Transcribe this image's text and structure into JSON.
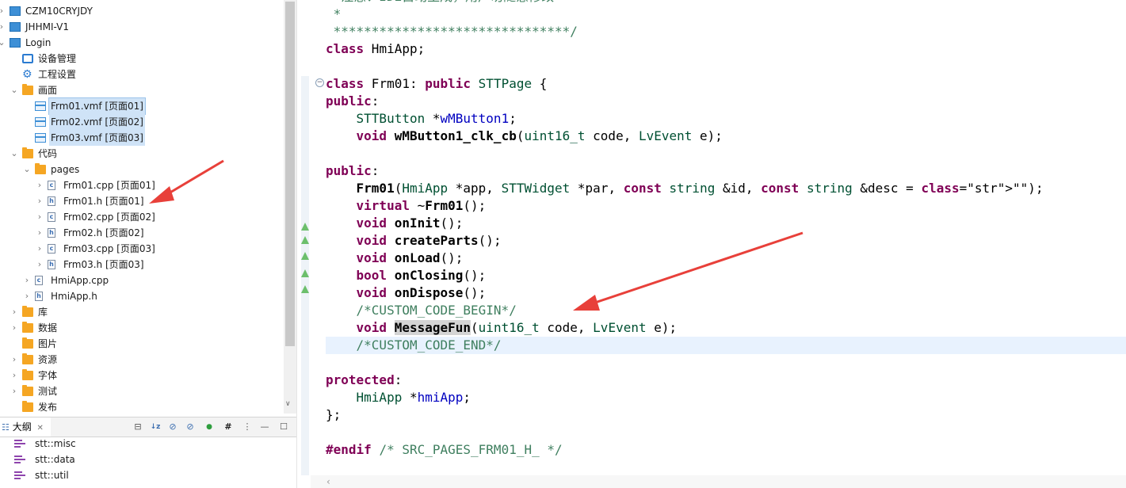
{
  "project_tree": {
    "items": [
      {
        "label": "CZM10CRYJDY",
        "icon": "project-icon",
        "twisty": "collapsed"
      },
      {
        "label": "JHHMI-V1",
        "icon": "project-icon",
        "twisty": "collapsed"
      },
      {
        "label": "Login",
        "icon": "project-icon",
        "twisty": "expanded"
      },
      {
        "label": "设备管理",
        "icon": "device-icon",
        "twisty": ""
      },
      {
        "label": "工程设置",
        "icon": "gear-icon",
        "twisty": ""
      },
      {
        "label": "画面",
        "icon": "folder-icon",
        "twisty": "expanded"
      },
      {
        "label": "Frm01.vmf [页面01]",
        "icon": "vmf-file-icon",
        "twisty": ""
      },
      {
        "label": "Frm02.vmf [页面02]",
        "icon": "vmf-file-icon",
        "twisty": ""
      },
      {
        "label": "Frm03.vmf [页面03]",
        "icon": "vmf-file-icon",
        "twisty": ""
      },
      {
        "label": "代码",
        "icon": "folder-icon",
        "twisty": "expanded"
      },
      {
        "label": "pages",
        "icon": "folder-icon",
        "twisty": "expanded"
      },
      {
        "label": "Frm01.cpp [页面01]",
        "icon": "cpp-file-icon",
        "twisty": "collapsed"
      },
      {
        "label": "Frm01.h [页面01]",
        "icon": "h-file-icon",
        "twisty": "collapsed"
      },
      {
        "label": "Frm02.cpp [页面02]",
        "icon": "cpp-file-icon",
        "twisty": "collapsed"
      },
      {
        "label": "Frm02.h [页面02]",
        "icon": "h-file-icon",
        "twisty": "collapsed"
      },
      {
        "label": "Frm03.cpp [页面03]",
        "icon": "cpp-file-icon",
        "twisty": "collapsed"
      },
      {
        "label": "Frm03.h [页面03]",
        "icon": "h-file-icon",
        "twisty": "collapsed"
      },
      {
        "label": "HmiApp.cpp",
        "icon": "cpp-file-icon",
        "twisty": "collapsed"
      },
      {
        "label": "HmiApp.h",
        "icon": "h-file-icon",
        "twisty": "collapsed"
      },
      {
        "label": "库",
        "icon": "folder-icon",
        "twisty": "collapsed"
      },
      {
        "label": "数据",
        "icon": "folder-icon",
        "twisty": "collapsed"
      },
      {
        "label": "图片",
        "icon": "image-folder-icon",
        "twisty": ""
      },
      {
        "label": "资源",
        "icon": "folder-icon",
        "twisty": "collapsed"
      },
      {
        "label": "字体",
        "icon": "folder-icon",
        "twisty": "collapsed"
      },
      {
        "label": "测试",
        "icon": "folder-icon",
        "twisty": "collapsed"
      },
      {
        "label": "发布",
        "icon": "folder-icon",
        "twisty": ""
      }
    ]
  },
  "outline": {
    "tab_label": "大纲",
    "close_glyph": "✕",
    "items": [
      "stt::misc",
      "stt::data",
      "stt::util"
    ]
  },
  "editor": {
    "fold_glyph": "−",
    "lines": [
      {
        "text": "  注意：IDE自动生成，用户勿随意修改"
      },
      {
        "text": " *"
      },
      {
        "text": " *******************************/"
      },
      {
        "text": "class HmiApp;"
      },
      {
        "text": ""
      },
      {
        "text": "class Frm01: public STTPage {"
      },
      {
        "text": "public:"
      },
      {
        "text": "    STTButton *wMButton1;"
      },
      {
        "text": "    void wMButton1_clk_cb(uint16_t code, LvEvent e);"
      },
      {
        "text": ""
      },
      {
        "text": "public:"
      },
      {
        "text": "    Frm01(HmiApp *app, STTWidget *par, const string &id, const string &desc = \"\");"
      },
      {
        "text": "    virtual ~Frm01();"
      },
      {
        "text": "    void onInit();"
      },
      {
        "text": "    void createParts();"
      },
      {
        "text": "    void onLoad();"
      },
      {
        "text": "    bool onClosing();"
      },
      {
        "text": "    void onDispose();"
      },
      {
        "text": "    /*CUSTOM_CODE_BEGIN*/"
      },
      {
        "text": "    void MessageFun(uint16_t code, LvEvent e);"
      },
      {
        "text": "    /*CUSTOM_CODE_END*/"
      },
      {
        "text": ""
      },
      {
        "text": "protected:"
      },
      {
        "text": "    HmiApp *hmiApp;"
      },
      {
        "text": "};"
      },
      {
        "text": ""
      },
      {
        "text": "#endif /* SRC_PAGES_FRM01_H_ */"
      }
    ]
  },
  "colors": {
    "keyword": "#7f0055",
    "type": "#005032",
    "field": "#0000c0",
    "comment": "#3f7f5f",
    "string": "#2a00ff",
    "annotation_arrow": "#e8403a"
  }
}
